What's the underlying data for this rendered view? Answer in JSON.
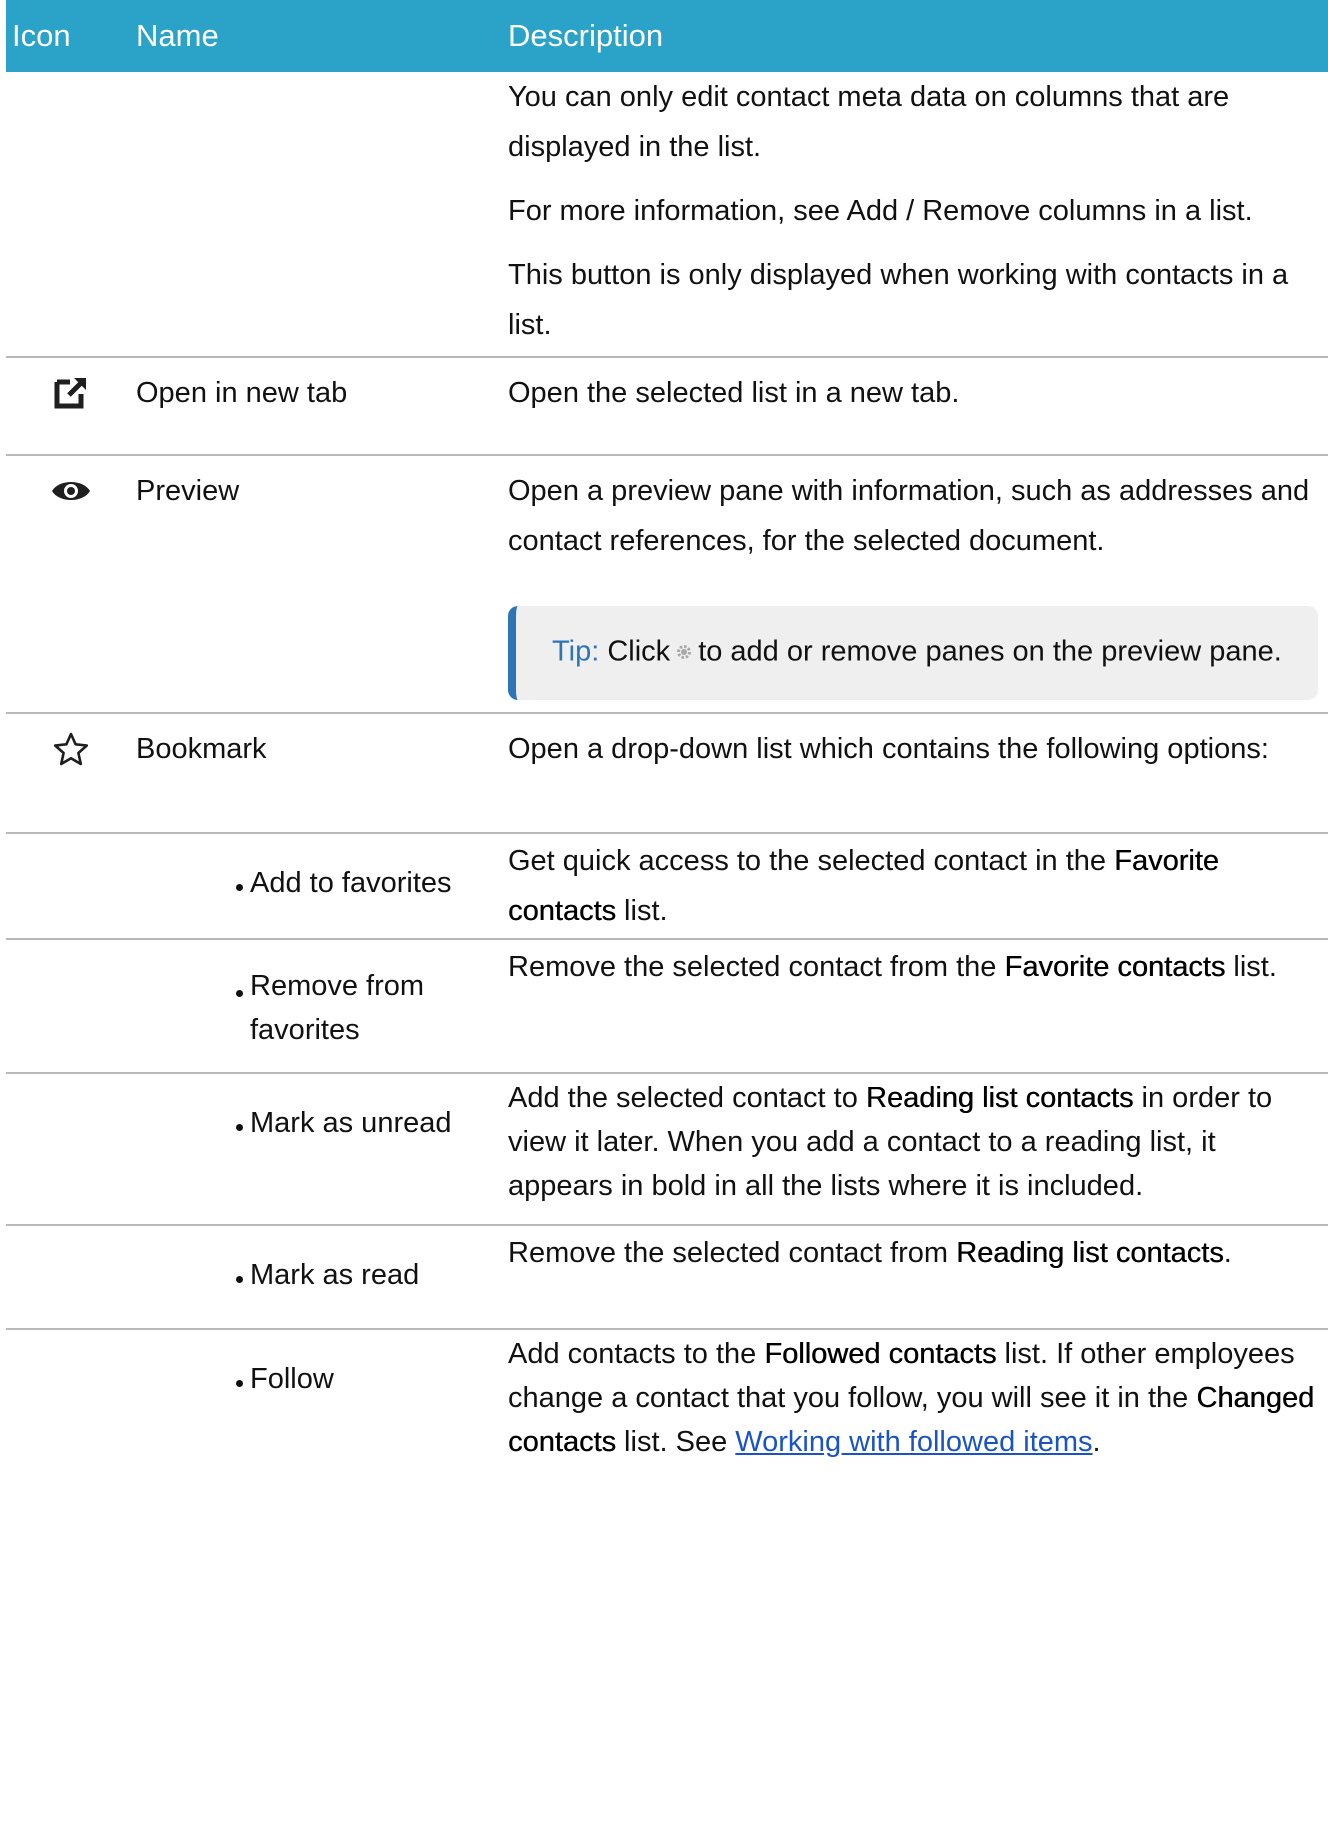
{
  "header": {
    "icon": "Icon",
    "name": "Name",
    "description": "Description"
  },
  "edit_row": {
    "p1": "You can only edit contact meta data on columns that are displayed in the list.",
    "p2": "For more information, see Add / Remove columns in a list.",
    "p3": "This button is only displayed when working with contacts in a list."
  },
  "rows": {
    "open_new_tab": {
      "icon": "open-new-tab-icon",
      "name": "Open in new tab",
      "desc": "Open the selected list in a new tab."
    },
    "preview": {
      "icon": "eye-icon",
      "name": "Preview",
      "desc": "Open a preview pane with information, such as addresses and contact references, for the selected doc­ument.",
      "tip_label": "Tip:",
      "tip_pre": "Click",
      "tip_post": "to add or remove panes on the pre­view pane."
    },
    "bookmark": {
      "icon": "star-icon",
      "name": "Bookmark",
      "desc": "Open a drop-down list which contains the following options:"
    }
  },
  "options": {
    "add_fav": {
      "name": "Add to favorites",
      "d1": "Get quick access to the selected contact in the ",
      "b1": "Favorite contacts",
      "d2": " list."
    },
    "remove_fav": {
      "name": "Remove from favorites",
      "d1": "Remove the selected contact from the ",
      "b1": "Favorite contacts",
      "d2": " list."
    },
    "unread": {
      "name": "Mark as unread",
      "d1": "Add the selected contact to ",
      "b1": "Reading list contacts",
      "d2": " in order to view it later. When you add a contact to a reading list, it appears in bold in all the lists where it is included."
    },
    "read": {
      "name": "Mark as read",
      "d1": "Remove the selected contact from ",
      "b1": "Reading list contacts",
      "d2": "."
    },
    "follow": {
      "name": "Follow",
      "d1": "Add contacts to the ",
      "b1": "Followed contacts",
      "d2": " list. If other employees change a contact that you follow, you will see it in the ",
      "b2": "Changed contacts",
      "d3": " list. See ",
      "link": "Working with fol­lowed items",
      "d4": "."
    }
  },
  "colors": {
    "header_bg": "#2ba3c9",
    "tip_accent": "#2e75b6",
    "link": "#1a53c6"
  }
}
